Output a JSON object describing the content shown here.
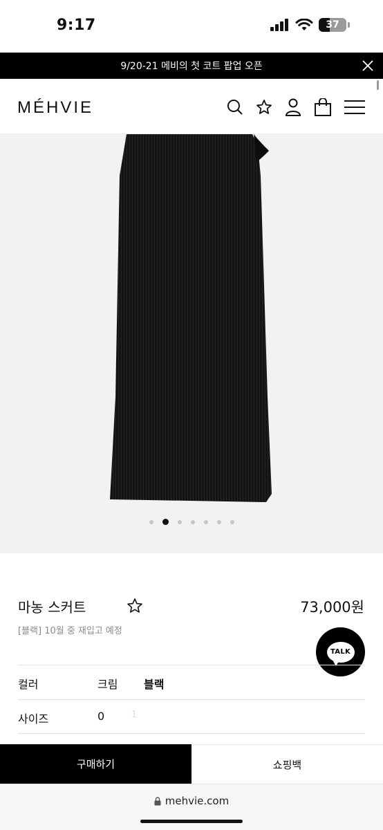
{
  "status_bar": {
    "time": "9:17",
    "battery": "37"
  },
  "promo": {
    "text": "9/20-21 메비의 첫 코트 팝업 오픈"
  },
  "header": {
    "logo": "MÉHVIE",
    "icons": [
      "search-icon",
      "star-icon",
      "user-icon",
      "shopping-bag-icon",
      "menu-icon"
    ]
  },
  "gallery": {
    "slide_count": 7,
    "active_index": 1
  },
  "product": {
    "name": "마농 스커트",
    "price": "73,000원",
    "restock_note": "[블랙] 10월 중 재입고 예정"
  },
  "talk": {
    "label": "TALK"
  },
  "options": {
    "color": {
      "label": "컬러",
      "values": [
        "크림",
        "블랙"
      ],
      "selected": "블랙"
    },
    "size": {
      "label": "사이즈",
      "values": [
        "0",
        "1"
      ]
    }
  },
  "actions": {
    "buy": "구매하기",
    "cart": "쇼핑백"
  },
  "browser": {
    "url": "mehvie.com"
  },
  "colors": {
    "accent": "#000000",
    "background": "#ffffff",
    "gallery_bg": "#f2f2f2",
    "muted_text": "#8a8a8a"
  }
}
